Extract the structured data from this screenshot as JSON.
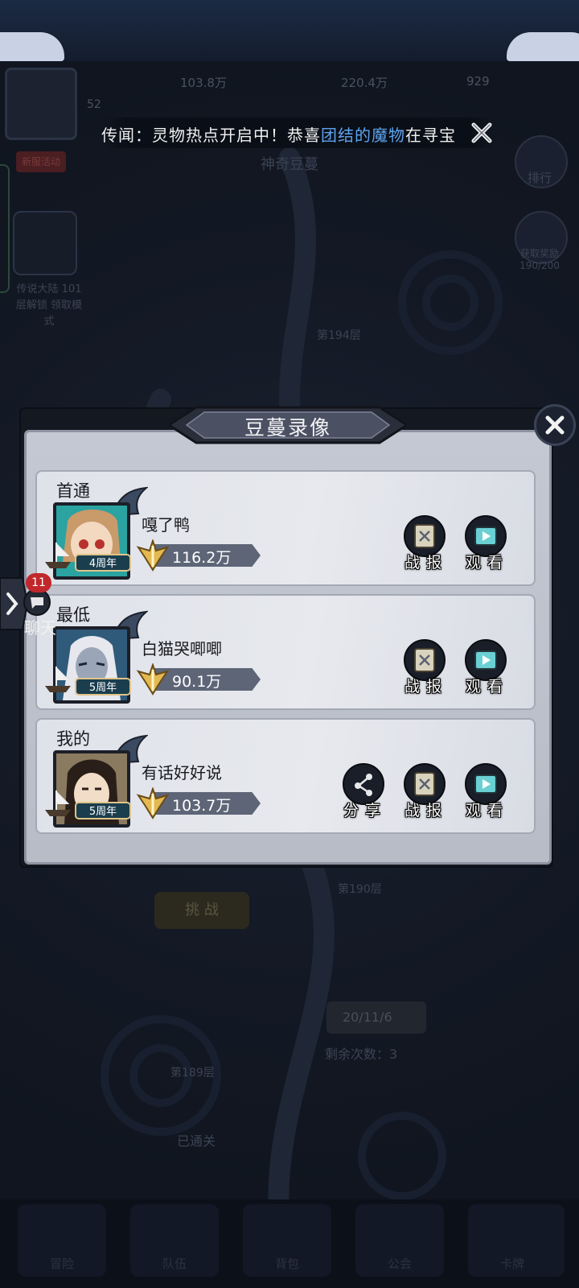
{
  "background": {
    "resources": [
      "103.8万",
      "220.4万",
      "929"
    ],
    "player_level": "52",
    "vip_badge": "新服活动",
    "left_button_text": "传说大陆 101层解锁 领取模式",
    "right_buttons": [
      {
        "label": "排行",
        "icon": "trophy-icon"
      },
      {
        "label": "获取奖励 190/200",
        "icon": "gift-icon"
      }
    ],
    "dim_title": "神奇豆蔓",
    "floors": [
      "第194层",
      "第190层",
      "第189层"
    ],
    "challenge_label": "挑 战",
    "remain_value": "20/11/6",
    "remain_label": "剩余次数：3",
    "passed_label": "已通关",
    "bottom_tabs": [
      "冒险",
      "队伍",
      "背包",
      "公会",
      "卡牌"
    ]
  },
  "rumor": {
    "prefix": "传闻：灵物热点开启中！恭喜",
    "highlight": "团结的魔物",
    "suffix": "在寻宝"
  },
  "chat": {
    "badge": "11",
    "label": "聊天"
  },
  "dialog": {
    "title": "豆蔓录像",
    "records": [
      {
        "label": "首通",
        "player": "嘎了鸭",
        "power": "116.2万",
        "avatar": "girl-avatar-icon",
        "actions": [
          "战报",
          "观看"
        ]
      },
      {
        "label": "最低",
        "player": "白猫哭唧唧",
        "power": "90.1万",
        "avatar": "sage-avatar-icon",
        "actions": [
          "战报",
          "观看"
        ]
      },
      {
        "label": "我的",
        "player": "有话好好说",
        "power": "103.7万",
        "avatar": "lady-avatar-icon",
        "actions": [
          "分享",
          "战报",
          "观看"
        ]
      }
    ]
  },
  "badges": {
    "anniversary": "4周年",
    "anniversary_alt": "5周年"
  },
  "colors": {
    "accent": "#5da4ee",
    "badge_red": "#c0282c",
    "avatar_teal": "#2c9c9a",
    "panel": "#c4c8d2"
  }
}
